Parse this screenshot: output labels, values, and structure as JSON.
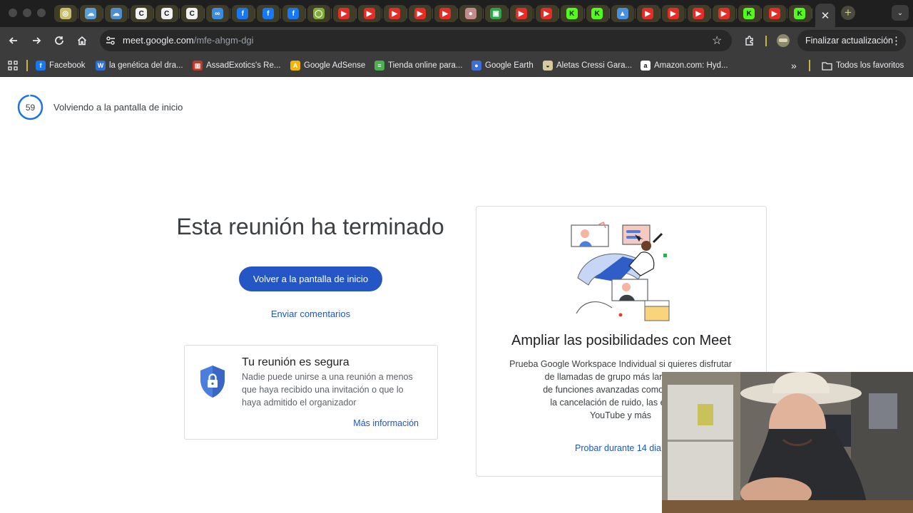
{
  "browser": {
    "tabs": [
      {
        "icon": "chrome-icon",
        "color": "#c9bf6a",
        "glyph": "◎"
      },
      {
        "icon": "onedrive-icon",
        "color": "#5aa0d8",
        "glyph": "☁"
      },
      {
        "icon": "onedrive-icon",
        "color": "#4d8fd1",
        "glyph": "☁"
      },
      {
        "icon": "cursive-c-icon",
        "color": "#f2f2f2",
        "glyph": "C"
      },
      {
        "icon": "cursive-c-icon",
        "color": "#f2f2f2",
        "glyph": "C"
      },
      {
        "icon": "cursive-c-icon",
        "color": "#f2f2f2",
        "glyph": "C"
      },
      {
        "icon": "meta-icon",
        "color": "#3d8bdc",
        "glyph": "∞"
      },
      {
        "icon": "facebook-icon",
        "color": "#1877f2",
        "glyph": "f"
      },
      {
        "icon": "facebook-icon",
        "color": "#1877f2",
        "glyph": "f"
      },
      {
        "icon": "facebook-icon",
        "color": "#1877f2",
        "glyph": "f"
      },
      {
        "icon": "green-circle-icon",
        "color": "#7fae3a",
        "glyph": "◯"
      },
      {
        "icon": "youtube-icon",
        "color": "#e52d27",
        "glyph": "▶"
      },
      {
        "icon": "youtube-icon",
        "color": "#e52d27",
        "glyph": "▶"
      },
      {
        "icon": "youtube-icon",
        "color": "#e52d27",
        "glyph": "▶"
      },
      {
        "icon": "youtube-icon",
        "color": "#e52d27",
        "glyph": "▶"
      },
      {
        "icon": "youtube-icon",
        "color": "#e52d27",
        "glyph": "▶"
      },
      {
        "icon": "pink-blob-icon",
        "color": "#c58b8b",
        "glyph": "●"
      },
      {
        "icon": "green-app-icon",
        "color": "#2ea44f",
        "glyph": "▣"
      },
      {
        "icon": "youtube-icon",
        "color": "#e52d27",
        "glyph": "▶"
      },
      {
        "icon": "youtube-icon",
        "color": "#e52d27",
        "glyph": "▶"
      },
      {
        "icon": "kick-icon",
        "color": "#53fc18",
        "glyph": "K"
      },
      {
        "icon": "kick-icon",
        "color": "#53fc18",
        "glyph": "K"
      },
      {
        "icon": "google-drive-icon",
        "color": "#4a90e2",
        "glyph": "▲"
      },
      {
        "icon": "youtube-icon",
        "color": "#e52d27",
        "glyph": "▶"
      },
      {
        "icon": "youtube-icon",
        "color": "#e52d27",
        "glyph": "▶"
      },
      {
        "icon": "youtube-icon",
        "color": "#e52d27",
        "glyph": "▶"
      },
      {
        "icon": "youtube-icon",
        "color": "#e52d27",
        "glyph": "▶"
      },
      {
        "icon": "kick-icon",
        "color": "#53fc18",
        "glyph": "K"
      },
      {
        "icon": "youtube-icon",
        "color": "#e52d27",
        "glyph": "▶"
      },
      {
        "icon": "kick-icon",
        "color": "#53fc18",
        "glyph": "K"
      }
    ],
    "active_tab_close": "✕",
    "url_host": "meet.google.com",
    "url_path": "/mfe-ahgm-dgi",
    "update_button": "Finalizar actualización",
    "bookmarks": [
      {
        "label": "Facebook",
        "icon": "facebook-icon",
        "color": "#1877f2",
        "glyph": "f"
      },
      {
        "label": "la genética del dra...",
        "icon": "wordpress-w-icon",
        "color": "#2d6ed6",
        "glyph": "W"
      },
      {
        "label": "AssadExotics's Re...",
        "icon": "chart-favicon-icon",
        "color": "#c0392b",
        "glyph": "▥"
      },
      {
        "label": "Google AdSense",
        "icon": "adsense-icon",
        "color": "#f4b400",
        "glyph": "A"
      },
      {
        "label": "Tienda online para...",
        "icon": "store-icon",
        "color": "#4caf50",
        "glyph": "≡"
      },
      {
        "label": "Google Earth",
        "icon": "google-earth-icon",
        "color": "#3b6fd8",
        "glyph": "●"
      },
      {
        "label": "Aletas Cressi Gara...",
        "icon": "cressi-icon",
        "color": "#d8c9a0",
        "glyph": "◒"
      },
      {
        "label": "Amazon.com: Hyd...",
        "icon": "amazon-icon",
        "color": "#ffffff",
        "glyph": "a"
      }
    ],
    "all_bookmarks": "Todos los favoritos"
  },
  "page": {
    "countdown": "59",
    "countdown_progress": 0.98,
    "countdown_label": "Volviendo a la pantalla de inicio",
    "title": "Esta reunión ha terminado",
    "home_button": "Volver a la pantalla de inicio",
    "feedback_link": "Enviar comentarios",
    "secure_card": {
      "title": "Tu reunión es segura",
      "text": "Nadie puede unirse a una reunión a menos que haya recibido una invitación o que lo haya admitido el organizador",
      "link": "Más información"
    },
    "promo_card": {
      "title": "Ampliar las posibilidades con Meet",
      "lines": [
        "Prueba Google Workspace Individual si quieres disfrutar",
        "de llamadas de grupo más largas de u",
        "de funciones avanzadas como la graba",
        "la cancelación de ruido, las emision",
        "YouTube y más"
      ],
      "link": "Probar durante 14 dia"
    }
  },
  "colors": {
    "primary_button": "#2457c5",
    "link": "#1a56c8",
    "countdown_ring": "#1a73e8"
  }
}
